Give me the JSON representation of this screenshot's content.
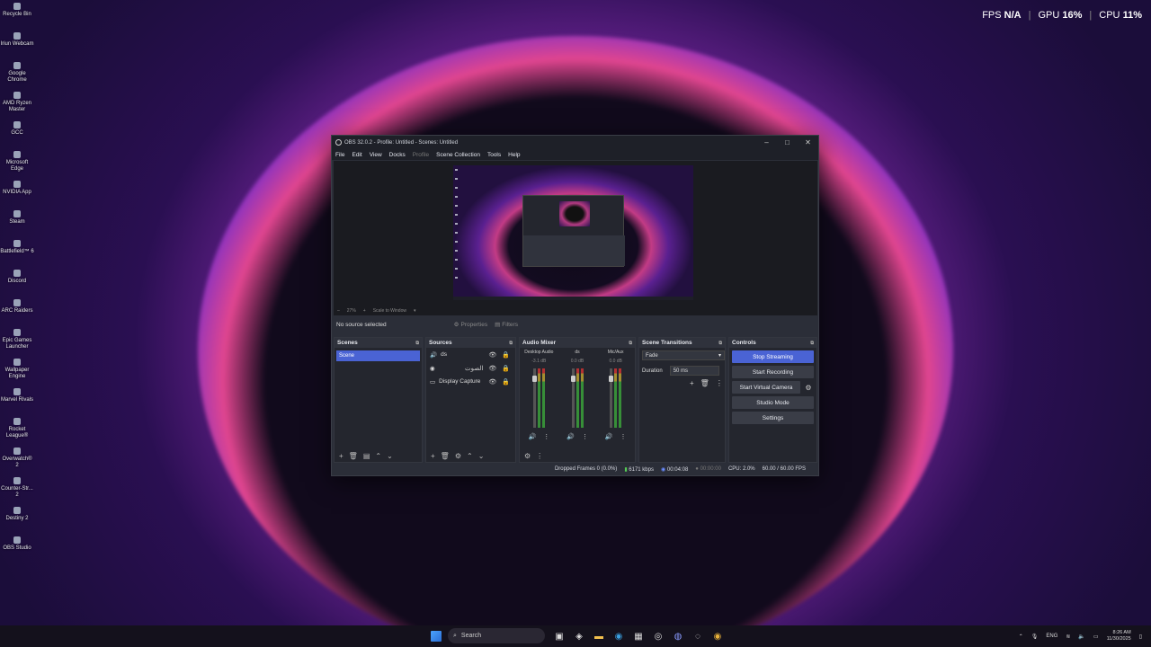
{
  "desktop": {
    "icons": [
      {
        "label": "Recycle Bin"
      },
      {
        "label": "Iriun Webcam"
      },
      {
        "label": "Google Chrome"
      },
      {
        "label": "AMD Ryzen Master"
      },
      {
        "label": "GCC"
      },
      {
        "label": "Microsoft Edge"
      },
      {
        "label": "NVIDIA App"
      },
      {
        "label": "Steam"
      },
      {
        "label": "Battlefield™ 6"
      },
      {
        "label": "Discord"
      },
      {
        "label": "ARC Raiders"
      },
      {
        "label": "Epic Games Launcher"
      },
      {
        "label": "Wallpaper Engine"
      },
      {
        "label": "Marvel Rivals"
      },
      {
        "label": "Rocket League®"
      },
      {
        "label": "Overwatch® 2"
      },
      {
        "label": "Counter-Str... 2"
      },
      {
        "label": "Destiny 2"
      },
      {
        "label": "OBS Studio"
      }
    ]
  },
  "overlay": {
    "fps_label": "FPS",
    "fps_value": "N/A",
    "gpu_label": "GPU",
    "gpu_value": "16%",
    "cpu_label": "CPU",
    "cpu_value": "11%"
  },
  "obs": {
    "title": "OBS 32.0.2 - Profile: Untitled - Scenes: Untitled",
    "menu": [
      "File",
      "Edit",
      "View",
      "Docks",
      "Profile",
      "Scene Collection",
      "Tools",
      "Help"
    ],
    "zoom": "27%",
    "scale_mode": "Scale to Window",
    "no_source": "No source selected",
    "properties": "Properties",
    "filters": "Filters",
    "scenes": {
      "title": "Scenes",
      "items": [
        "Scene"
      ]
    },
    "sources": {
      "title": "Sources",
      "items": [
        {
          "name": "ds"
        },
        {
          "name": "الصوت"
        },
        {
          "name": "Display Capture"
        }
      ]
    },
    "mixer": {
      "title": "Audio Mixer",
      "channels": [
        {
          "name": "Desktop Audio",
          "db": "-3.1 dB"
        },
        {
          "name": "ds",
          "db": "0.0 dB"
        },
        {
          "name": "Mic/Aux",
          "db": "0.0 dB"
        }
      ]
    },
    "transitions": {
      "title": "Scene Transitions",
      "selected": "Fade",
      "duration_label": "Duration",
      "duration_value": "50 ms"
    },
    "controls": {
      "title": "Controls",
      "stop_streaming": "Stop Streaming",
      "start_recording": "Start Recording",
      "start_virtual_camera": "Start Virtual Camera",
      "studio_mode": "Studio Mode",
      "settings": "Settings"
    },
    "status": {
      "dropped": "Dropped Frames 0 (0.0%)",
      "bitrate": "6171 kbps",
      "stream_time": "00:04:08",
      "rec_time": "00:00:00",
      "cpu": "CPU: 2.0%",
      "fps": "60.00 / 60.00 FPS"
    }
  },
  "taskbar": {
    "search_placeholder": "Search",
    "lang": "ENG",
    "time": "8:26 AM",
    "date": "11/30/2025"
  }
}
